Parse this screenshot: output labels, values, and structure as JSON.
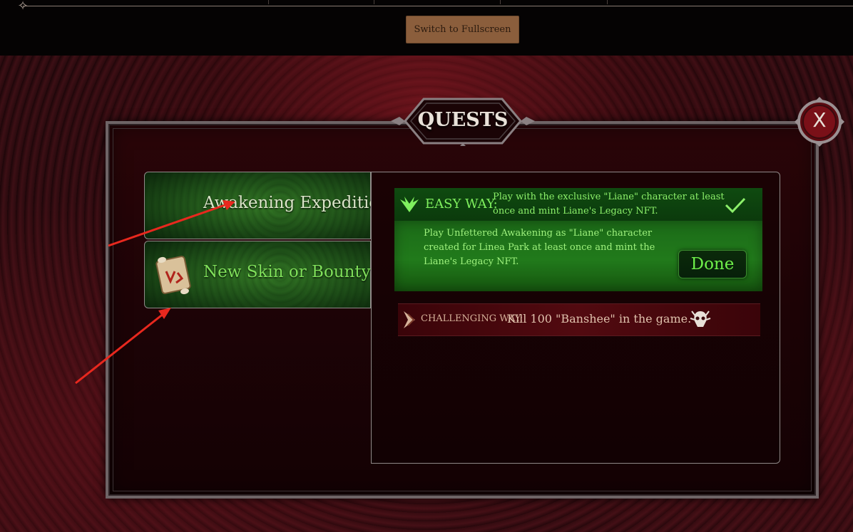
{
  "toolbar": {
    "fullscreen_label": "Switch to Fullscreen"
  },
  "dialog": {
    "title": "QUESTS",
    "close_label": "X"
  },
  "tabs": [
    {
      "label": "Awakening Expedition",
      "state": "selected"
    },
    {
      "label": "New Skin or Bounty",
      "icon": "scroll-icon"
    }
  ],
  "quests": {
    "easy": {
      "label": "EASY WAY:",
      "icon": "wing-icon",
      "description": "Play with the exclusive \"Liane\" character at least once and mint Liane's Legacy NFT.",
      "detail": "Play Unfettered Awakening as \"Liane\" character created for Linea Park at least once and mint the Liane's Legacy NFT.",
      "status_icon": "checkmark-icon",
      "button_label": "Done"
    },
    "challenging": {
      "label": "CHALLENGING WAY:",
      "icon": "wing-icon",
      "description": "Kill 100 \"Banshee\" in the game.",
      "reward_icon": "banshee-skull-icon"
    }
  },
  "colors": {
    "easy_accent": "#7ff05e",
    "challenge_accent": "#d6b29a",
    "fullscreen_button": "#8b5e3c",
    "frame": "#6e6466"
  }
}
